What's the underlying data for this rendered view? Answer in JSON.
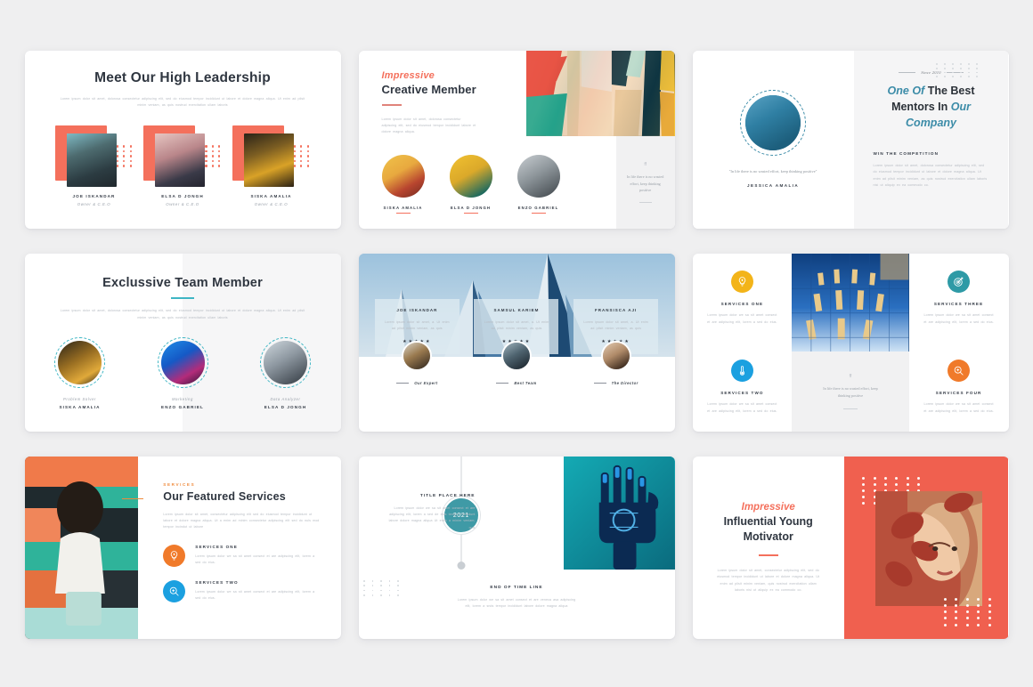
{
  "colors": {
    "background": "#efeff0",
    "coral": "#f4705c",
    "coral_deep": "#f0604f",
    "teal": "#3fb6c4",
    "teal_blue": "#3c8ca8",
    "teal_year": "#3f9aa6",
    "orange": "#ef8a3c",
    "yellow": "#f3b419",
    "blue": "#1ba0e0",
    "dark_text": "#2f3640",
    "muted_text": "#b7bcc3"
  },
  "lorem": {
    "long": "Lorem ipsum dolor sit amet, dolorosa consectetur adipiscing elit, sed do eiusmod tempor incididunt ut labore et dolore magna aliqua. Ut enim ad pilsit minim veniam, as quis nostrud exercitation ullam laboris",
    "medium": "Lorem ipsum dolor sit amet, dolorosa consectetur adipiscing elit, sed do eiusmod tempor incididunt labore et dolore magna aliqua.",
    "short": "Lorem ipsum dolor we sa sit amet consect et are adipiscing elit, lorem a sed do eius.",
    "card": "Lorem ipsum dolor sit amet, a. Ut enim ad pilsit minim veniam, as quis",
    "services_para": "Lorem ipsum dolor sit amet, consectetur adipiscing elit sed do eiusmod tempor incididunt ut labore et dolore magna aliqua. Ut a enim ad minim consectetur adipiscing elit sed do nuls mod tempor incindut ut labore",
    "timeline_left": "Lorem ipsum dolor we sa sit amet consect et are adipiscing elit, lorem a sed de eius tempor incididunt labore dolore magna aliqua Ut enim a minim veniam, quis",
    "timeline_end": "Lorem ipsum dolor we sa sit amet consect et are veneca asa adipiscing elit, lorem a snds tempor incididunt labore dolore magna aliqua",
    "mentors": "Lorem ipsum dolor sit amet, dolorosa consectetur adipiscing elit, sed do eiusmod tempor incididunt ut labore et dolore magna aliqua. Ut enim ad pilsit minim veniam, as quis nostrud exercitation ullam laboris nisi ut aliquip ex ea commodo co.",
    "motivator": "Lorem ipsum dolor sit amet, consectetur adipiscing elit, sed do eiusmod tempor incididunt ut labore et dolore magna aliqua. Ut enim ad pilsit minim veniam, quis nostrud exercitation ullam laboris nisi ut aliquip ex ea commodo co."
  },
  "quote": {
    "mark": "ff",
    "text": "In life there is no wasted effort, keep thinking positive",
    "text_quoted": "\"In life there is no wasted effort, keep thinking positive\"",
    "author": "JESSICA AMALIA"
  },
  "slide1": {
    "title": "Meet Our High Leadership",
    "members": [
      {
        "name": "JOE ISKANDAR",
        "role": "Owner & C.E.O"
      },
      {
        "name": "ELSA D JONGH",
        "role": "Owner & C.E.O"
      },
      {
        "name": "SISKA AMALIA",
        "role": "Owner & C.E.O"
      }
    ]
  },
  "slide2": {
    "eyebrow": "Impressive",
    "title": "Creative Member",
    "members": [
      {
        "name": "SISKA AMALIA"
      },
      {
        "name": "ELSA D JONGH"
      },
      {
        "name": "ENZO GABRIEL"
      }
    ]
  },
  "slide3": {
    "since": "Since 2010",
    "headline_parts": [
      {
        "text": "One Of",
        "accent": true
      },
      {
        "text": " The Best Mentors In ",
        "accent": false
      },
      {
        "text": "Our Company",
        "accent": true
      }
    ],
    "headline_line1_a": "One Of",
    "headline_line1_b": " The Best",
    "headline_line2_a": "Mentors In ",
    "headline_line2_b": "Our",
    "headline_line3": "Company",
    "section_title": "WIN THE COMPETITION"
  },
  "slide4": {
    "title": "Exclussive Team Member",
    "members": [
      {
        "role": "Problem Solver",
        "name": "SISKA AMALIA"
      },
      {
        "role": "Marketing",
        "name": "ENZO GABRIEL"
      },
      {
        "role": "Data Analyzer",
        "name": "ELSA D JONGH"
      }
    ]
  },
  "slide5": {
    "cards": [
      {
        "name": "JOE ISKANDAR",
        "stars": "★★★★★",
        "role": "Our Expert"
      },
      {
        "name": "SAMSUL KARIEM",
        "stars": "★★★★★",
        "role": "Best Team"
      },
      {
        "name": "FRANSISCA AJI",
        "stars": "★★★★★",
        "role": "The Director"
      }
    ]
  },
  "slide6": {
    "services": [
      {
        "title": "SERVICES ONE",
        "icon": "lightbulb-icon",
        "color": "#f3b419"
      },
      {
        "title": "SERVICES TWO",
        "icon": "thermometer-icon",
        "color": "#1ba0e0"
      },
      {
        "title": "SERVICES THREE",
        "icon": "target-icon",
        "color": "#2e9aa6"
      },
      {
        "title": "SERVICES FOUR",
        "icon": "search-icon",
        "color": "#f07a2a"
      }
    ]
  },
  "slide7": {
    "kicker": "SERVICES",
    "title": "Our Featured Services",
    "items": [
      {
        "title": "SERVICES ONE",
        "icon": "lightbulb-icon",
        "color": "#f07a2a"
      },
      {
        "title": "SERVICES TWO",
        "icon": "search-icon",
        "color": "#1ba0e0"
      }
    ]
  },
  "slide8": {
    "block_title": "TITLE PLACE HERE",
    "year": "2021",
    "end_title": "END OF TIME LINE"
  },
  "slide9": {
    "eyebrow": "Impressive",
    "title_line1": "Influential Young",
    "title_line2": "Motivator"
  }
}
